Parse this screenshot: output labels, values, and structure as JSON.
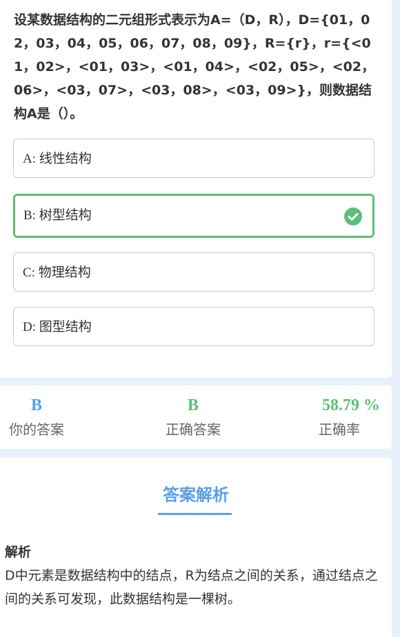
{
  "question": {
    "text": "设某数据结构的二元组形式表示为A=（D，R），D={01，02，03，04，05，06，07，08，09}，R={r}，r={<01，02>，<01，03>，<01，04>，<02，05>，<02，06>，<03，07>，<03，08>，<03，09>}，则数据结构A是（）。"
  },
  "options": [
    {
      "label": "A: 线性结构"
    },
    {
      "label": "B: 树型结构",
      "correct": true
    },
    {
      "label": "C: 物理结构"
    },
    {
      "label": "D: 图型结构"
    }
  ],
  "stats": {
    "your_answer": {
      "value": "B",
      "label": "你的答案"
    },
    "correct_answer": {
      "value": "B",
      "label": "正确答案"
    },
    "accuracy": {
      "value": "58.79 %",
      "label": "正确率"
    }
  },
  "analysis": {
    "title": "答案解析",
    "heading": "解析",
    "body": "D中元素是数据结构中的结点，R为结点之间的关系，通过结点之间的关系可发现，此数据结构是一棵树。"
  },
  "colors": {
    "accent": "#5a9fe6",
    "correct": "#5cbf76",
    "background": "#e7f0fb"
  },
  "icons": {
    "correct_mark": "check-circle-icon"
  }
}
